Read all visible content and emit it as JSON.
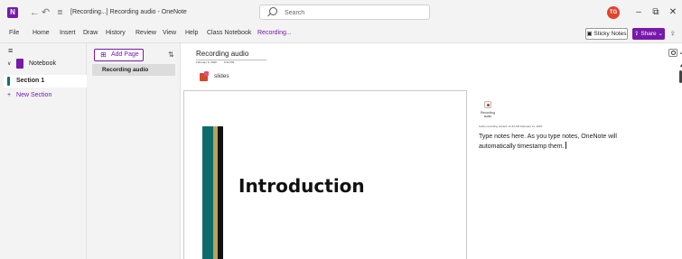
{
  "titlebar": {
    "title": "[Recording...] Recording audio  -  OneNote",
    "app_icon_glyph": "N",
    "icons": [
      "onenote-app-icon",
      "back-icon",
      "undo-icon",
      "customize-quick-access-icon"
    ],
    "search_placeholder": "Search",
    "avatar_initials": "TG",
    "avatar_color": "#e0442c",
    "window_buttons": [
      "minimize-icon",
      "restore-icon",
      "close-icon"
    ]
  },
  "menubar": {
    "items": [
      "File",
      "Home",
      "Insert",
      "Draw",
      "History",
      "Review",
      "View",
      "Help",
      "Class Notebook",
      "Recording..."
    ],
    "active_item": "Recording...",
    "sticky_notes_label": "Sticky Notes",
    "share_label": "Share",
    "accent_color": "#7719aa"
  },
  "leftnav": {
    "notebook_label": "Notebook",
    "section_label": "Section 1",
    "section_color": "#0f6e6e",
    "new_section_label": "New Section"
  },
  "pagelist": {
    "add_page_label": "Add Page",
    "pages": [
      "Recording audio"
    ],
    "selected_page": "Recording audio"
  },
  "page": {
    "title": "Recording audio",
    "date": "February 6, 2020",
    "time": "9:44 PM",
    "attachment_label": "slides",
    "slide_heading": "Introduction",
    "audio_label": "Recording audio",
    "audio_meta": "Audio recording started: 11:44 AM February 11, 2020",
    "notes_text": "Type notes here. As you type notes, OneNote will automatically timestamp them."
  }
}
